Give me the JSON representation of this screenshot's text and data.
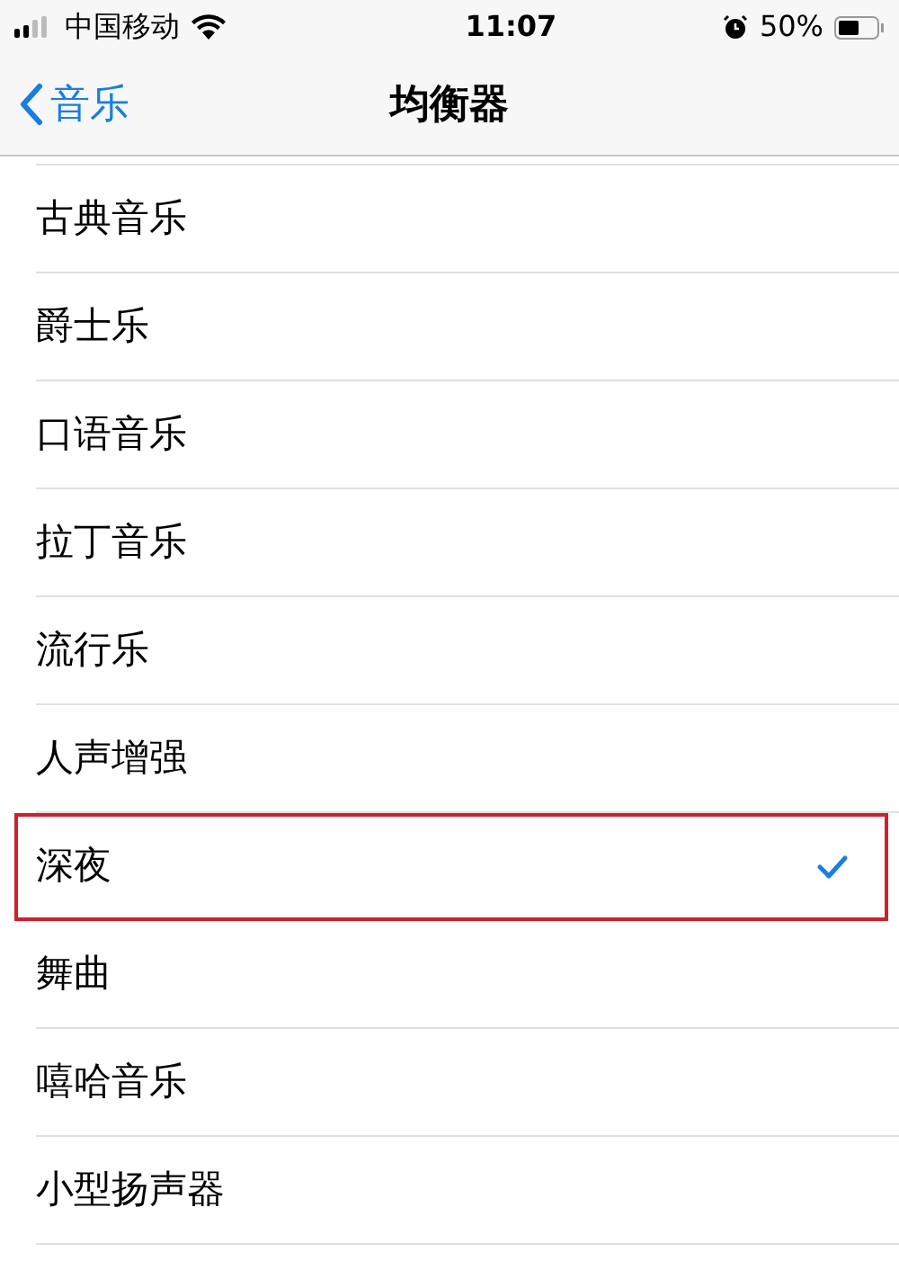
{
  "status_bar": {
    "carrier": "中国移动",
    "time": "11:07",
    "battery": "50%"
  },
  "nav": {
    "back": "音乐",
    "title": "均衡器"
  },
  "items": [
    {
      "label": "古典音乐",
      "selected": false,
      "highlighted": false
    },
    {
      "label": "爵士乐",
      "selected": false,
      "highlighted": false
    },
    {
      "label": "口语音乐",
      "selected": false,
      "highlighted": false
    },
    {
      "label": "拉丁音乐",
      "selected": false,
      "highlighted": false
    },
    {
      "label": "流行乐",
      "selected": false,
      "highlighted": false
    },
    {
      "label": "人声增强",
      "selected": false,
      "highlighted": false
    },
    {
      "label": "深夜",
      "selected": true,
      "highlighted": true
    },
    {
      "label": "舞曲",
      "selected": false,
      "highlighted": false
    },
    {
      "label": "嘻哈音乐",
      "selected": false,
      "highlighted": false
    },
    {
      "label": "小型扬声器",
      "selected": false,
      "highlighted": false
    }
  ]
}
